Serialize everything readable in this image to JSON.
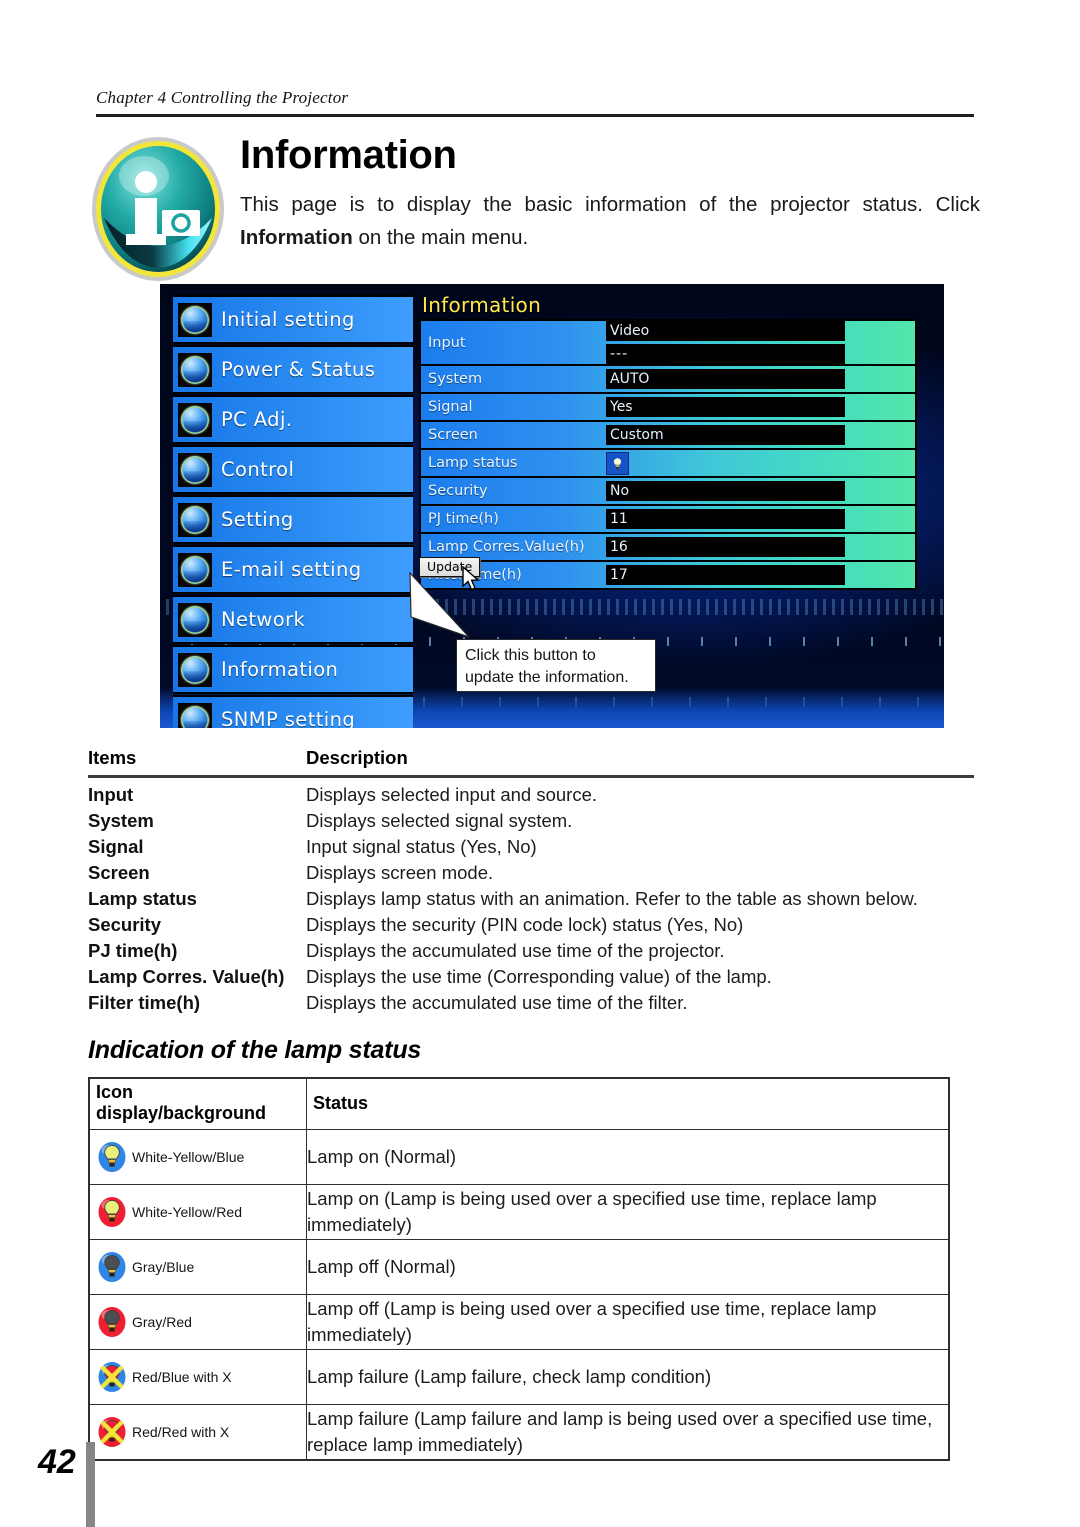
{
  "document": {
    "chapter_head": "Chapter 4 Controlling the Projector",
    "page_number": "42",
    "title": "Information",
    "intro_part1": "This page is to display the basic information of the projector status. Click ",
    "intro_bold": "Information",
    "intro_part2": " on the main menu."
  },
  "screenshot": {
    "menu": {
      "items": [
        {
          "label": "Initial setting",
          "icon": "initial-setting-icon"
        },
        {
          "label": "Power & Status",
          "icon": "power-status-icon"
        },
        {
          "label": "PC Adj.",
          "icon": "pc-adj-icon"
        },
        {
          "label": "Control",
          "icon": "control-icon"
        },
        {
          "label": "Setting",
          "icon": "setting-icon"
        },
        {
          "label": "E-mail setting",
          "icon": "email-setting-icon"
        },
        {
          "label": "Network",
          "icon": "network-icon"
        },
        {
          "label": "Information",
          "icon": "information-icon"
        },
        {
          "label": "SNMP setting",
          "icon": "snmp-setting-icon"
        }
      ]
    },
    "panel": {
      "title": "Information",
      "rows": [
        {
          "label": "Input",
          "value": "Video",
          "value2": "---"
        },
        {
          "label": "System",
          "value": "AUTO"
        },
        {
          "label": "Signal",
          "value": "Yes"
        },
        {
          "label": "Screen",
          "value": "Custom"
        },
        {
          "label": "Lamp status",
          "value": "",
          "icon": "lamp-on-icon"
        },
        {
          "label": "Security",
          "value": "No"
        },
        {
          "label": "PJ time(h)",
          "value": "11"
        },
        {
          "label": "Lamp Corres.Value(h)",
          "value": "16"
        },
        {
          "label": "Filter time(h)",
          "value": "17"
        }
      ],
      "update_button": "Update"
    },
    "callout": {
      "line1": "Click this button to",
      "line2": "update the information."
    }
  },
  "items_table": {
    "headers": {
      "items": "Items",
      "description": "Description"
    },
    "rows": [
      {
        "item": "Input",
        "description": "Displays selected input and source."
      },
      {
        "item": "System",
        "description": "Displays selected signal system."
      },
      {
        "item": "Signal",
        "description": "Input signal status (Yes, No)"
      },
      {
        "item": "Screen",
        "description": "Displays screen mode."
      },
      {
        "item": "Lamp status",
        "description": "Displays lamp status with an animation. Refer to the table as shown below."
      },
      {
        "item": "Security",
        "description": "Displays the security (PIN code lock) status (Yes, No)"
      },
      {
        "item": "PJ time(h)",
        "description": "Displays the accumulated use time of the projector."
      },
      {
        "item": "Lamp Corres. Value(h)",
        "description": "Displays the use time (Corresponding value) of the lamp."
      },
      {
        "item": "Filter time(h)",
        "description": "Displays the accumulated use time of the filter."
      }
    ]
  },
  "lamp_status": {
    "section_title": "Indication of the lamp status",
    "headers": {
      "icon": "Icon display/background",
      "status": "Status"
    },
    "rows": [
      {
        "icon_caption": "White-Yellow/Blue",
        "icon_name": "lamp-white-yellow-blue-icon",
        "bg": "#2f86e8",
        "bulb": "#e9ef7a",
        "cross": false,
        "status": "Lamp on (Normal)"
      },
      {
        "icon_caption": "White-Yellow/Red",
        "icon_name": "lamp-white-yellow-red-icon",
        "bg": "#ef2033",
        "bulb": "#e9ef7a",
        "cross": false,
        "status": "Lamp on (Lamp is being used over a specified use time, replace lamp immediately)"
      },
      {
        "icon_caption": "Gray/Blue",
        "icon_name": "lamp-gray-blue-icon",
        "bg": "#2f86e8",
        "bulb": "#4b4f52",
        "cross": false,
        "status": "Lamp off (Normal)"
      },
      {
        "icon_caption": "Gray/Red",
        "icon_name": "lamp-gray-red-icon",
        "bg": "#ef2033",
        "bulb": "#4b4f52",
        "cross": false,
        "status": "Lamp off (Lamp is being used over a specified use time, replace lamp immediately)"
      },
      {
        "icon_caption": "Red/Blue with X",
        "icon_name": "lamp-red-blue-cross-icon",
        "bg": "#2f86e8",
        "bulb": "#ef2033",
        "cross": true,
        "status": "Lamp failure (Lamp failure, check lamp condition)"
      },
      {
        "icon_caption": "Red/Red with X",
        "icon_name": "lamp-red-red-cross-icon",
        "bg": "#ef2033",
        "bulb": "#ef2033",
        "cross": true,
        "status": "Lamp failure (Lamp failure and lamp is being used over a specified use time, replace lamp immediately)"
      }
    ]
  },
  "colors": {
    "accent_yellow": "#ffe84a",
    "panel_blue": "#1b7ced",
    "panel_teal": "#52e6a9",
    "badge_teal": "#1aa3a0",
    "rule_dark": "#231f20"
  }
}
